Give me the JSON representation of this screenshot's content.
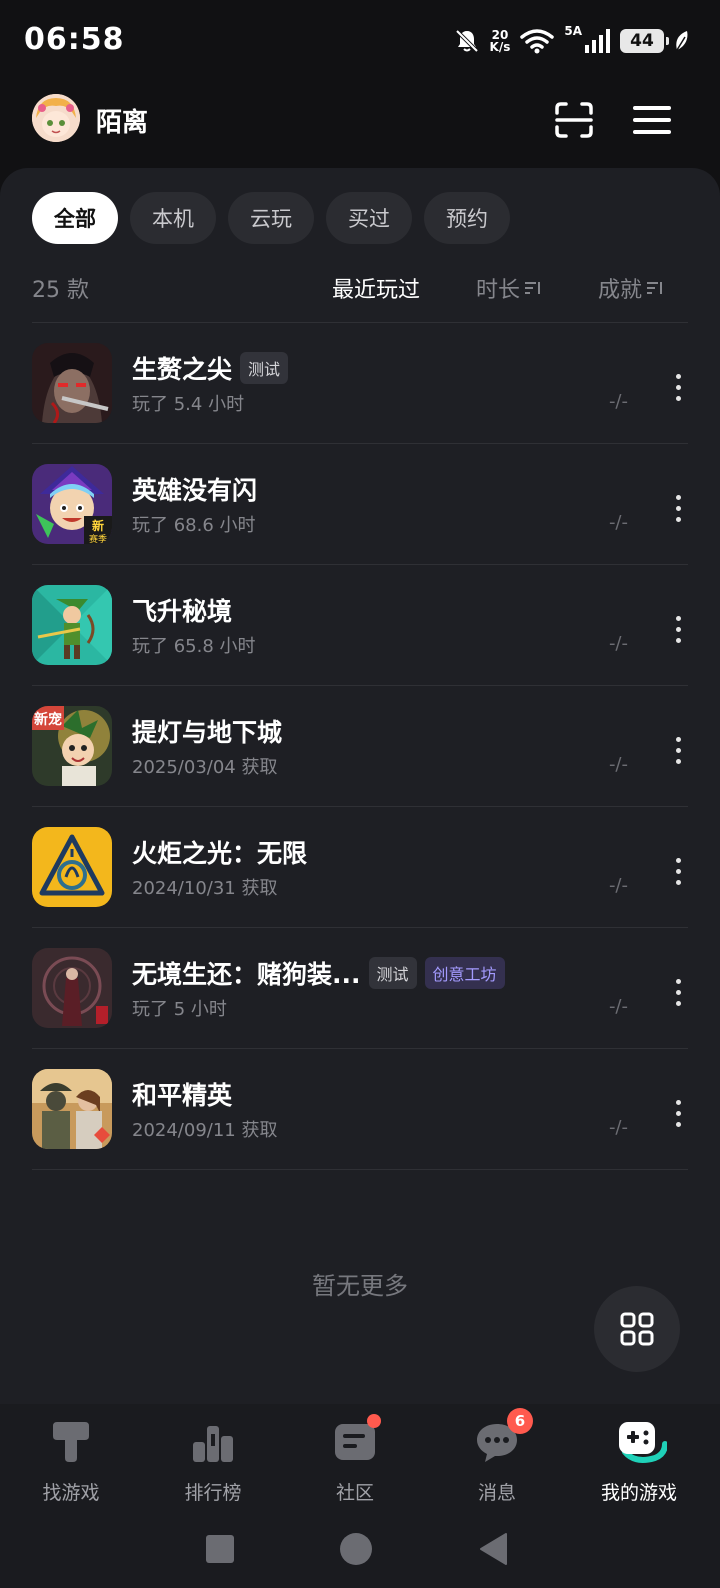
{
  "status_bar": {
    "time": "06:58",
    "net_speed_value": "20",
    "net_speed_unit": "K/s",
    "signal_label": "5A",
    "battery": "44"
  },
  "header": {
    "username": "陌离",
    "icons": [
      "avatar",
      "scan-icon",
      "menu-icon"
    ]
  },
  "tabs": [
    {
      "label": "全部",
      "active": true
    },
    {
      "label": "本机",
      "active": false
    },
    {
      "label": "云玩",
      "active": false
    },
    {
      "label": "买过",
      "active": false
    },
    {
      "label": "预约",
      "active": false
    }
  ],
  "sort": {
    "count": "25 款",
    "recent": "最近玩过",
    "duration": "时长",
    "achievement": "成就"
  },
  "games": [
    {
      "title": "生赘之尖",
      "tags": [
        {
          "text": "测试",
          "style": "gray"
        }
      ],
      "sub": "玩了 5.4 小时",
      "ach": "-/-"
    },
    {
      "title": "英雄没有闪",
      "tags": [],
      "sub": "玩了 68.6 小时",
      "ach": "-/-"
    },
    {
      "title": "飞升秘境",
      "tags": [],
      "sub": "玩了 65.8 小时",
      "ach": "-/-"
    },
    {
      "title": "提灯与地下城",
      "tags": [],
      "sub": "2025/03/04 获取",
      "ach": "-/-"
    },
    {
      "title": "火炬之光：无限",
      "tags": [],
      "sub": "2024/10/31 获取",
      "ach": "-/-"
    },
    {
      "title": "无境生还：赌狗装...",
      "tags": [
        {
          "text": "测试",
          "style": "gray"
        },
        {
          "text": "创意工坊",
          "style": "purple"
        }
      ],
      "sub": "玩了 5 小时",
      "ach": "-/-"
    },
    {
      "title": "和平精英",
      "tags": [],
      "sub": "2024/09/11 获取",
      "ach": "-/-"
    }
  ],
  "icon_texts": {
    "game2_badge": "新赛季",
    "game4_badge": "新宠"
  },
  "no_more": "暂无更多",
  "bottom_nav": [
    {
      "label": "找游戏",
      "icon": "find-game-icon"
    },
    {
      "label": "排行榜",
      "icon": "ranking-icon"
    },
    {
      "label": "社区",
      "icon": "community-icon",
      "dot": true
    },
    {
      "label": "消息",
      "icon": "message-icon",
      "badge": "6"
    },
    {
      "label": "我的游戏",
      "icon": "my-games-icon",
      "active": true
    }
  ],
  "colors": {
    "background": "#111113",
    "panel": "#1e1f24",
    "accent_teal": "#1fd1b8",
    "badge_red": "#ff5a4e",
    "tag_purple": "#a49bff"
  }
}
